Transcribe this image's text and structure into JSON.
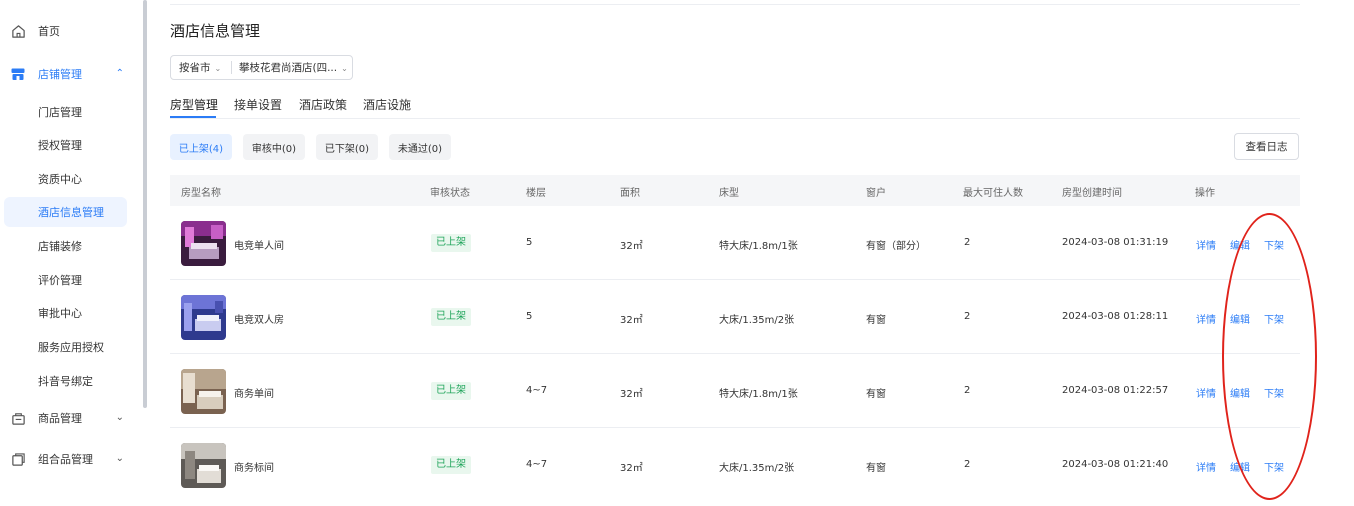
{
  "sidebar": {
    "home": "首页",
    "store_mgmt": "店铺管理",
    "subitems": [
      "门店管理",
      "授权管理",
      "资质中心",
      "酒店信息管理",
      "店铺装修",
      "评价管理",
      "审批中心",
      "服务应用授权",
      "抖音号绑定"
    ],
    "goods_mgmt": "商品管理",
    "combo_mgmt": "组合品管理",
    "accent_color": "#2b7cf6"
  },
  "page": {
    "title": "酒店信息管理",
    "picker": {
      "region": "按省市",
      "hotel": "攀枝花君尚酒店(四..."
    },
    "tabs": [
      "房型管理",
      "接单设置",
      "酒店政策",
      "酒店设施"
    ],
    "filters": [
      "已上架(4)",
      "审核中(0)",
      "已下架(0)",
      "未通过(0)"
    ],
    "log_button": "查看日志"
  },
  "table": {
    "headers": [
      "房型名称",
      "审核状态",
      "楼层",
      "面积",
      "床型",
      "窗户",
      "最大可住人数",
      "房型创建时间",
      "操作"
    ],
    "rows": [
      {
        "name": "电竞单人间",
        "status": "已上架",
        "floor": "5",
        "area": "32㎡",
        "bed": "特大床/1.8m/1张",
        "window": "有窗（部分）",
        "max": "2",
        "created": "2024-03-08 01:31:19"
      },
      {
        "name": "电竞双人房",
        "status": "已上架",
        "floor": "5",
        "area": "32㎡",
        "bed": "大床/1.35m/2张",
        "window": "有窗",
        "max": "2",
        "created": "2024-03-08 01:28:11"
      },
      {
        "name": "商务单间",
        "status": "已上架",
        "floor": "4~7",
        "area": "32㎡",
        "bed": "特大床/1.8m/1张",
        "window": "有窗",
        "max": "2",
        "created": "2024-03-08 01:22:57"
      },
      {
        "name": "商务标间",
        "status": "已上架",
        "floor": "4~7",
        "area": "32㎡",
        "bed": "大床/1.35m/2张",
        "window": "有窗",
        "max": "2",
        "created": "2024-03-08 01:21:40"
      }
    ],
    "ops": [
      "详情",
      "编辑",
      "下架"
    ]
  }
}
